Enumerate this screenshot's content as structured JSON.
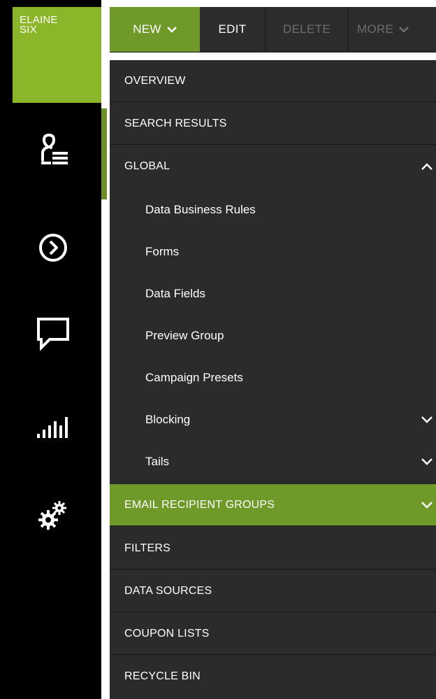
{
  "brand": {
    "line1": "ELAINE",
    "line2": "SIX",
    "color": "#8cb62a"
  },
  "accent": "#6f9a29",
  "rail_icons": [
    "user-list-icon",
    "chevron-circle-right-icon",
    "chat-bubble-icon",
    "signal-bars-icon",
    "gears-icon"
  ],
  "toolbar": {
    "new_label": "NEW",
    "edit_label": "EDIT",
    "delete_label": "DELETE",
    "more_label": "MORE"
  },
  "nav": {
    "overview": "OVERVIEW",
    "search_results": "SEARCH RESULTS",
    "global": "GLOBAL",
    "global_children": {
      "c0": "Data Business Rules",
      "c1": "Forms",
      "c2": "Data Fields",
      "c3": "Preview Group",
      "c4": "Campaign Presets",
      "c5": "Blocking",
      "c6": "Tails"
    },
    "email_recipient_groups": "EMAIL RECIPIENT GROUPS",
    "filters": "FILTERS",
    "data_sources": "DATA SOURCES",
    "coupon_lists": "COUPON LISTS",
    "recycle_bin": "RECYCLE BIN"
  }
}
